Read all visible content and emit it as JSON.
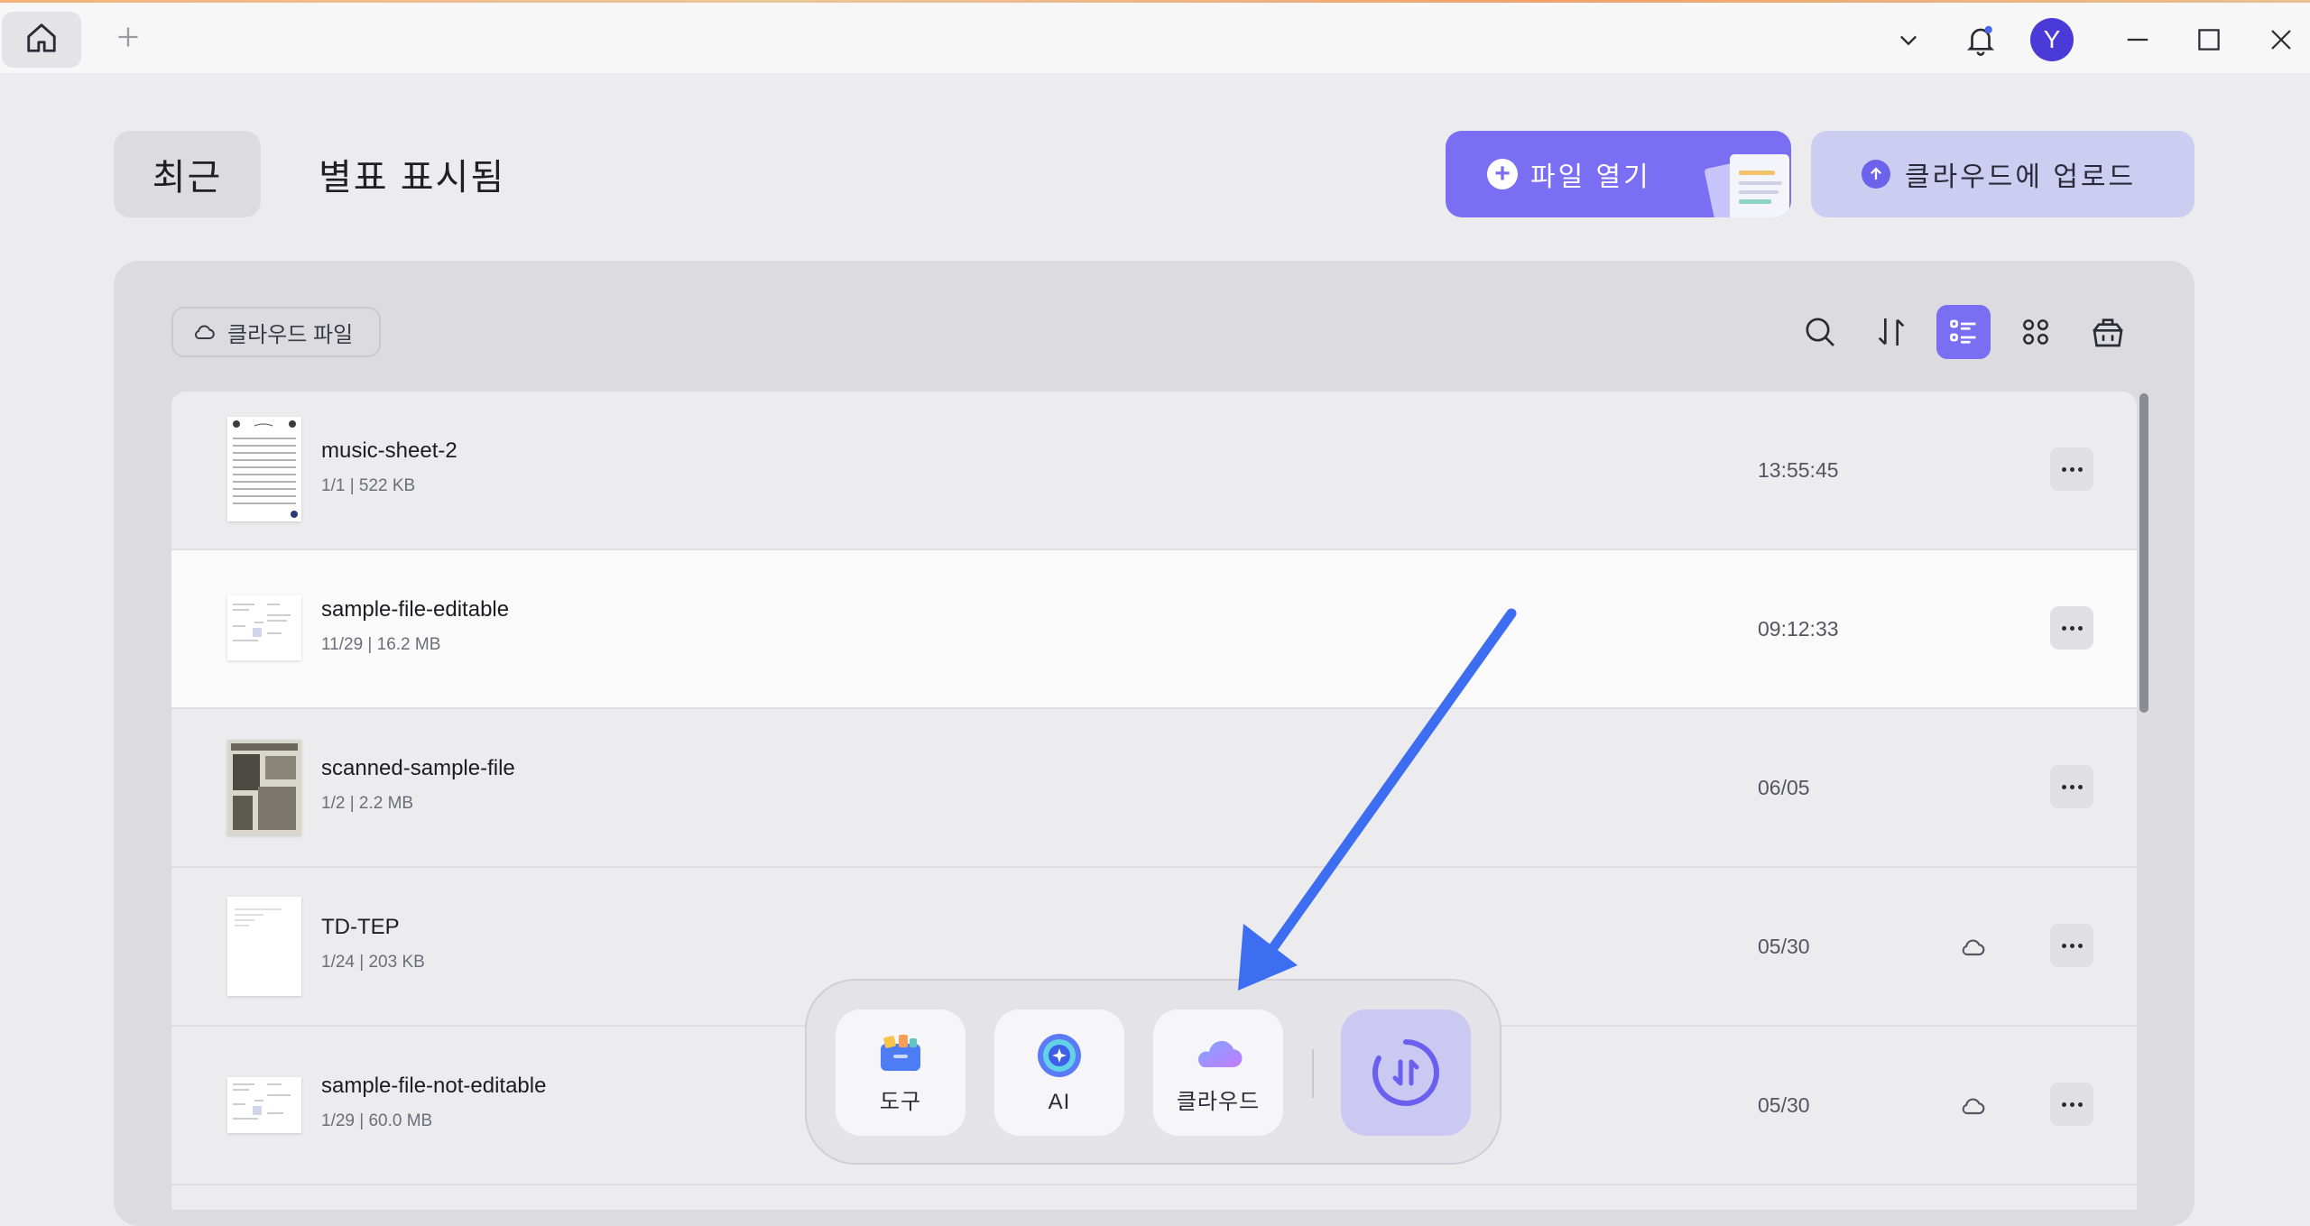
{
  "titlebar": {
    "user_initial": "Y",
    "icons": [
      "home-icon",
      "plus-icon",
      "chevron-down-icon",
      "bell-icon",
      "minimize-icon",
      "maximize-icon",
      "close-icon"
    ]
  },
  "tabs": {
    "recent": "최근",
    "starred": "별표 표시됨"
  },
  "actions": {
    "open_file": "파일 열기",
    "upload_cloud": "클라우드에 업로드"
  },
  "toolbar": {
    "cloud_files": "클라우드 파일",
    "icons": [
      "search-icon",
      "sort-icon",
      "list-view-icon",
      "grid-view-icon",
      "basket-icon"
    ],
    "active_view": "list"
  },
  "files": [
    {
      "name": "music-sheet-2",
      "meta": "1/1 | 522 KB",
      "time": "13:55:45",
      "cloud": false
    },
    {
      "name": "sample-file-editable",
      "meta": "11/29 | 16.2 MB",
      "time": "09:12:33",
      "cloud": false
    },
    {
      "name": "scanned-sample-file",
      "meta": "1/2 | 2.2 MB",
      "time": "06/05",
      "cloud": false
    },
    {
      "name": "TD-TEP",
      "meta": "1/24 | 203 KB",
      "time": "05/30",
      "cloud": true
    },
    {
      "name": "sample-file-not-editable",
      "meta": "1/29 | 60.0 MB",
      "time": "05/30",
      "cloud": true
    }
  ],
  "dock": {
    "tools": "도구",
    "ai": "AI",
    "cloud": "클라우드"
  },
  "colors": {
    "accent": "#7a6ff3",
    "annotation_arrow": "#3d6df0"
  }
}
